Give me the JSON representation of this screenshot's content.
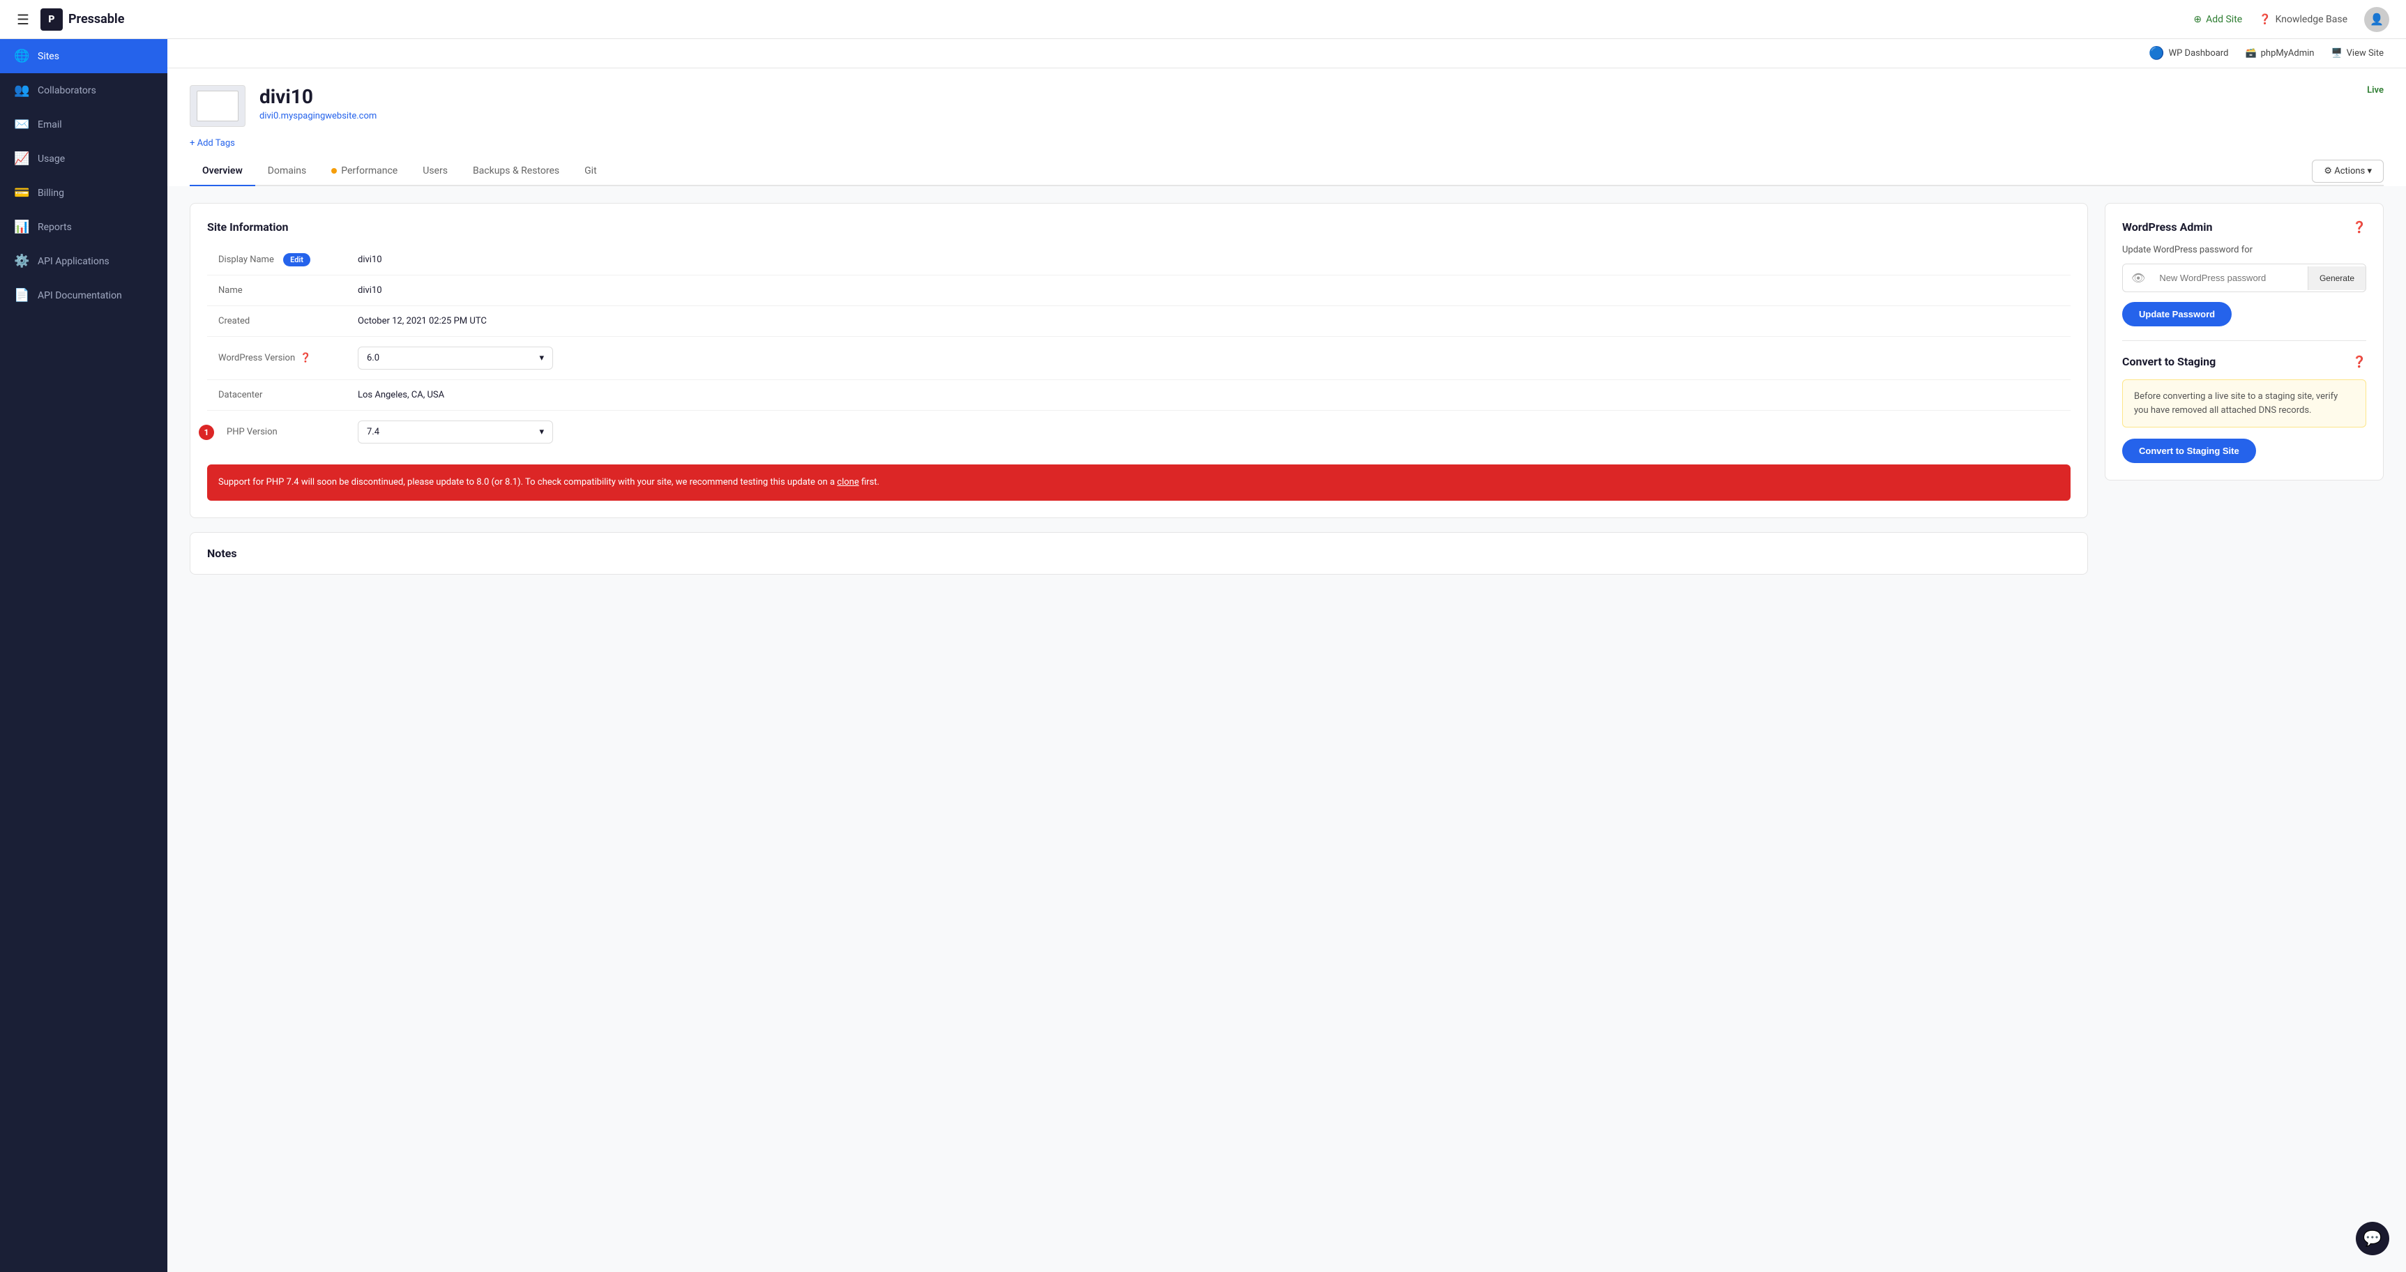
{
  "topbar": {
    "hamburger_label": "☰",
    "logo_icon": "P",
    "logo_text": "Pressable",
    "add_site_label": "Add Site",
    "knowledge_base_label": "Knowledge Base",
    "wp_dashboard_label": "WP Dashboard",
    "phpmyadmin_label": "phpMyAdmin",
    "view_site_label": "View Site"
  },
  "sidebar": {
    "items": [
      {
        "id": "sites",
        "label": "Sites",
        "icon": "🌐",
        "active": true
      },
      {
        "id": "collaborators",
        "label": "Collaborators",
        "icon": "👥",
        "active": false
      },
      {
        "id": "email",
        "label": "Email",
        "icon": "✉️",
        "active": false
      },
      {
        "id": "usage",
        "label": "Usage",
        "icon": "📈",
        "active": false
      },
      {
        "id": "billing",
        "label": "Billing",
        "icon": "💳",
        "active": false
      },
      {
        "id": "reports",
        "label": "Reports",
        "icon": "📊",
        "active": false
      },
      {
        "id": "api-applications",
        "label": "API Applications",
        "icon": "⚙️",
        "active": false
      },
      {
        "id": "api-documentation",
        "label": "API Documentation",
        "icon": "📄",
        "active": false
      }
    ]
  },
  "site": {
    "name": "divi10",
    "url": "divi0.myspagingwebsite.com",
    "status": "Live",
    "add_tags_label": "+ Add Tags",
    "tabs": [
      {
        "id": "overview",
        "label": "Overview",
        "active": true,
        "dot": false
      },
      {
        "id": "domains",
        "label": "Domains",
        "active": false,
        "dot": false
      },
      {
        "id": "performance",
        "label": "Performance",
        "active": false,
        "dot": true
      },
      {
        "id": "users",
        "label": "Users",
        "active": false,
        "dot": false
      },
      {
        "id": "backups",
        "label": "Backups & Restores",
        "active": false,
        "dot": false
      },
      {
        "id": "git",
        "label": "Git",
        "active": false,
        "dot": false
      }
    ],
    "actions_label": "⚙ Actions ▾"
  },
  "site_info": {
    "title": "Site Information",
    "rows": [
      {
        "label": "Display Name",
        "value": "divi10",
        "has_edit": true
      },
      {
        "label": "Name",
        "value": "divi10",
        "has_edit": false
      },
      {
        "label": "Created",
        "value": "October 12, 2021 02:25 PM UTC",
        "has_edit": false
      },
      {
        "label": "WordPress Version",
        "value": "6.0",
        "is_select": true,
        "has_edit": false
      },
      {
        "label": "Datacenter",
        "value": "Los Angeles, CA, USA",
        "has_edit": false
      },
      {
        "label": "PHP Version",
        "value": "7.4",
        "is_select": true,
        "has_badge": true,
        "badge_num": "1",
        "has_edit": false
      }
    ],
    "edit_label": "Edit",
    "warning": {
      "text": "Support for PHP 7.4 will soon be discontinued, please update to 8.0 (or 8.1). To check compatibility with your site, we recommend testing this update on a ",
      "link_text": "clone",
      "text_after": " first."
    }
  },
  "wp_admin": {
    "title": "WordPress Admin",
    "update_label": "Update WordPress password for",
    "password_placeholder": "New WordPress password",
    "generate_label": "Generate",
    "update_pw_label": "Update Password"
  },
  "convert_staging": {
    "title": "Convert to Staging",
    "notice": "Before converting a live site to a staging site, verify you have removed all attached DNS records.",
    "button_label": "Convert to Staging Site"
  },
  "notes": {
    "title": "Notes"
  }
}
